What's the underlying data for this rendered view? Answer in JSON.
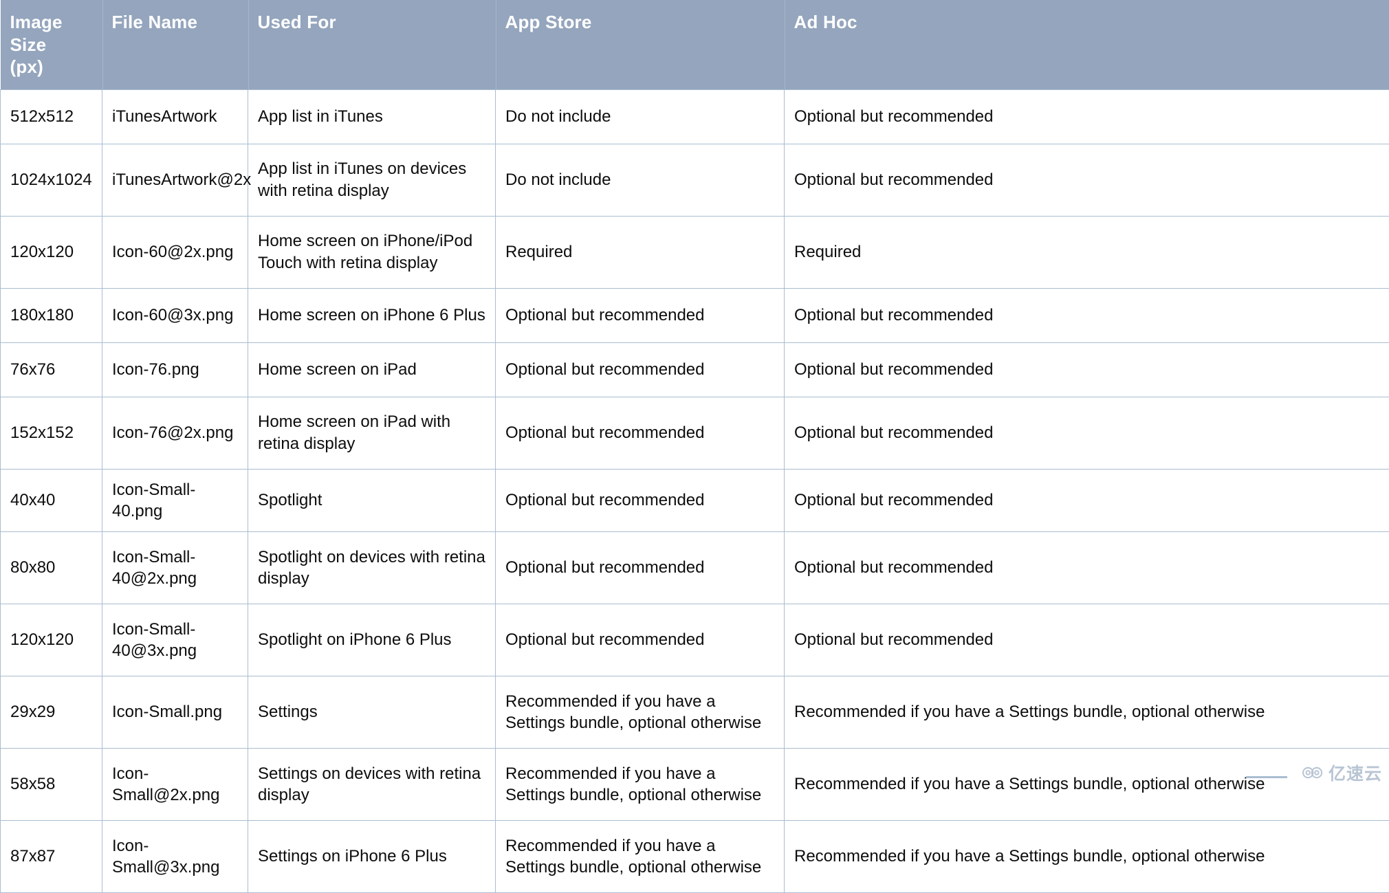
{
  "table": {
    "columns": [
      {
        "key": "size",
        "label": "Image Size (px)"
      },
      {
        "key": "file",
        "label": "File Name"
      },
      {
        "key": "used",
        "label": "Used For"
      },
      {
        "key": "appstore",
        "label": "App Store"
      },
      {
        "key": "adhoc",
        "label": "Ad Hoc"
      }
    ],
    "header_label_size_line1": "Image Size",
    "header_label_size_line2": "(px)",
    "rows": [
      {
        "size": "512x512",
        "file": "iTunesArtwork",
        "used": "App list in iTunes",
        "appstore": "Do not include",
        "adhoc": "Optional but recommended"
      },
      {
        "size": "1024x1024",
        "file": "iTunesArtwork@2x",
        "used": "App list in iTunes on devices with retina display",
        "appstore": "Do not include",
        "adhoc": "Optional but recommended"
      },
      {
        "size": "120x120",
        "file": "Icon-60@2x.png",
        "used": "Home screen on iPhone/iPod Touch with retina display",
        "appstore": "Required",
        "adhoc": "Required"
      },
      {
        "size": "180x180",
        "file": "Icon-60@3x.png",
        "used": "Home screen on iPhone 6 Plus",
        "appstore": "Optional but recommended",
        "adhoc": "Optional but recommended"
      },
      {
        "size": "76x76",
        "file": "Icon-76.png",
        "used": "Home screen on iPad",
        "appstore": "Optional but recommended",
        "adhoc": "Optional but recommended"
      },
      {
        "size": "152x152",
        "file": "Icon-76@2x.png",
        "used": "Home screen on iPad with retina display",
        "appstore": "Optional but recommended",
        "adhoc": "Optional but recommended"
      },
      {
        "size": "40x40",
        "file": "Icon-Small-40.png",
        "used": "Spotlight",
        "appstore": "Optional but recommended",
        "adhoc": "Optional but recommended"
      },
      {
        "size": "80x80",
        "file": "Icon-Small-40@2x.png",
        "used": "Spotlight on devices with retina display",
        "appstore": "Optional but recommended",
        "adhoc": "Optional but recommended"
      },
      {
        "size": "120x120",
        "file": "Icon-Small-40@3x.png",
        "used": "Spotlight on iPhone 6 Plus",
        "appstore": "Optional but recommended",
        "adhoc": "Optional but recommended"
      },
      {
        "size": "29x29",
        "file": "Icon-Small.png",
        "used": "Settings",
        "appstore": "Recommended if you have a Settings bundle, optional otherwise",
        "adhoc": "Recommended if you have a Settings bundle, optional otherwise"
      },
      {
        "size": "58x58",
        "file": "Icon-Small@2x.png",
        "used": "Settings on devices with retina display",
        "appstore": "Recommended if you have a Settings bundle, optional otherwise",
        "adhoc": "Recommended if you have a Settings bundle, optional otherwise"
      },
      {
        "size": "87x87",
        "file": "Icon-Small@3x.png",
        "used": "Settings on iPhone 6 Plus",
        "appstore": "Recommended if you have a Settings bundle, optional otherwise",
        "adhoc": "Recommended if you have a Settings bundle, optional otherwise"
      }
    ],
    "row_heights": [
      "short",
      "tall",
      "tall",
      "short",
      "short",
      "tall",
      "short",
      "tall",
      "tall",
      "tall",
      "tall",
      "tall"
    ]
  },
  "watermark": {
    "text": "亿速云",
    "icon": "cloud-icon"
  },
  "colors": {
    "header_bg": "#94a5bd",
    "header_text": "#ffffff",
    "border": "#a9bdd0",
    "cell_text": "#0d0d0d",
    "watermark": "#8fa3bb"
  }
}
